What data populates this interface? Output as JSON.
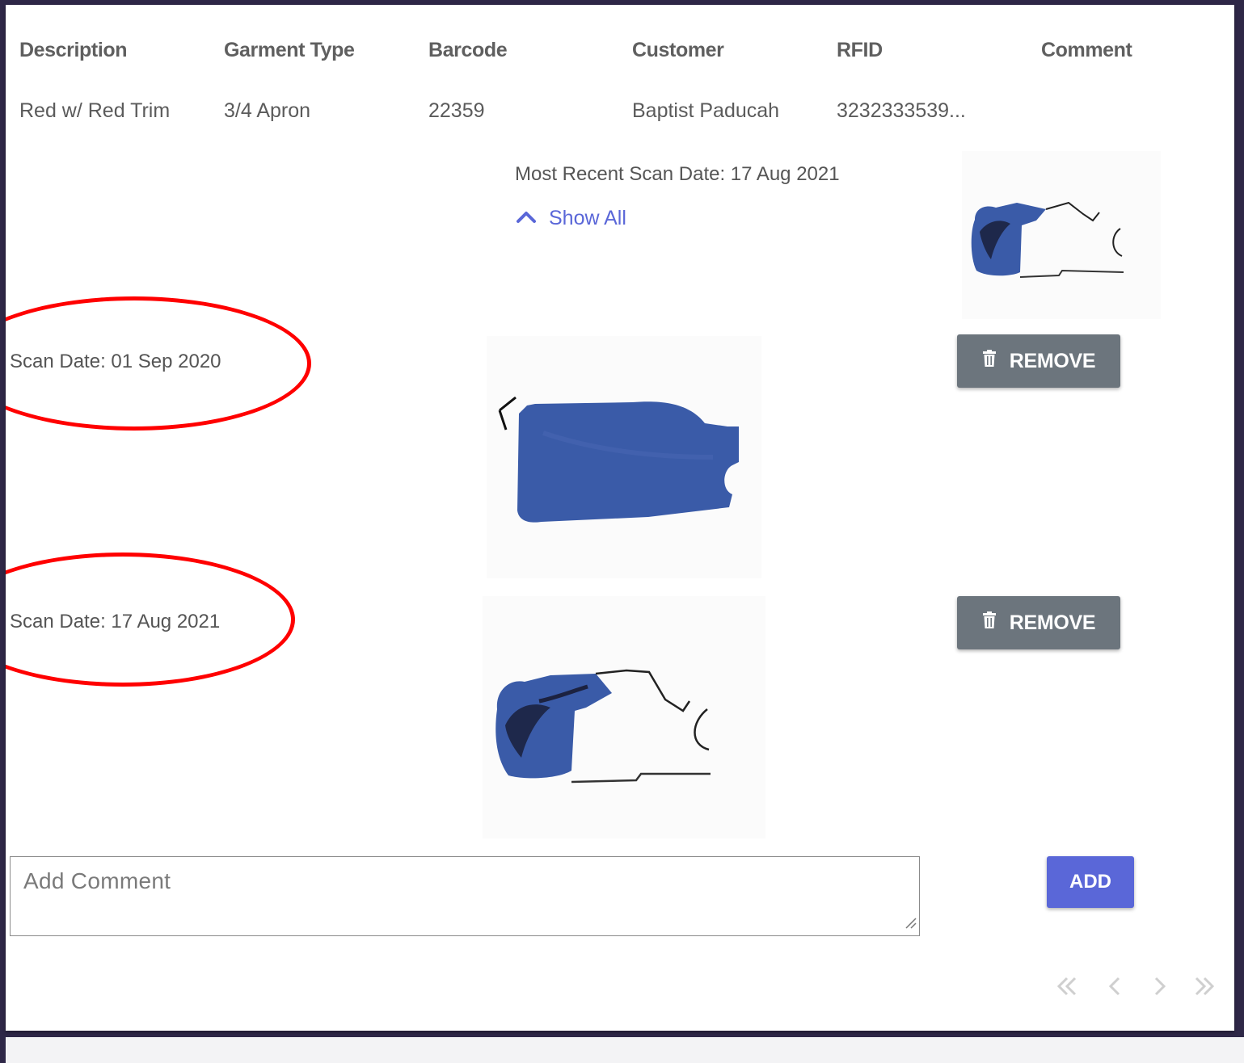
{
  "table": {
    "headers": [
      "Description",
      "Garment Type",
      "Barcode",
      "Customer",
      "RFID",
      "Comment"
    ],
    "row": {
      "description": "Red w/ Red Trim",
      "garment_type": "3/4 Apron",
      "barcode": "22359",
      "customer": "Baptist Paducah",
      "rfid": "3232333539...",
      "comment": ""
    }
  },
  "detail": {
    "most_recent": "Most Recent Scan Date: 17 Aug 2021",
    "show_all": "Show All"
  },
  "scans": [
    {
      "date_label": "Scan Date: 01 Sep 2020",
      "remove_label": "REMOVE"
    },
    {
      "date_label": "Scan Date: 17 Aug 2021",
      "remove_label": "REMOVE"
    }
  ],
  "comment_form": {
    "placeholder": "Add Comment",
    "value": "",
    "add_label": "ADD"
  },
  "colors": {
    "accent": "#5a67d8",
    "remove_button": "#6c757d",
    "garment_blue": "#3a5ba8",
    "annotation_red": "#ff0000",
    "frame": "#2e2747"
  },
  "icons": {
    "show_all": "chevron-up-icon",
    "remove": "trash-icon",
    "pager": [
      "double-chevron-left-icon",
      "chevron-left-icon",
      "chevron-right-icon",
      "double-chevron-right-icon"
    ]
  }
}
